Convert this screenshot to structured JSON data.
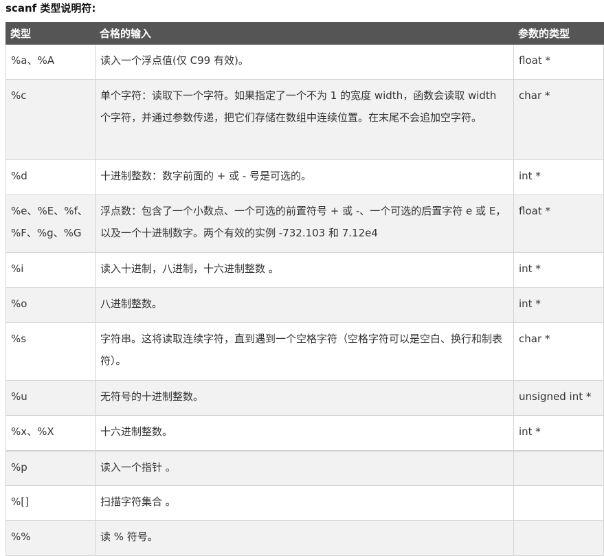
{
  "heading": "scanf 类型说明符:",
  "table": {
    "headers": [
      "类型",
      "合格的输入",
      "参数的类型"
    ],
    "rows": [
      {
        "type": "%a、%A",
        "input": "读入一个浮点值(仅 C99 有效)。",
        "arg": "float *"
      },
      {
        "type": "%c",
        "input": "单个字符：读取下一个字符。如果指定了一个不为 1 的宽度 width，函数会读取 width 个字符，并通过参数传递，把它们存储在数组中连续位置。在末尾不会追加空字符。",
        "arg": "char *"
      },
      {
        "type": "%d",
        "input": "十进制整数：数字前面的 + 或 - 号是可选的。",
        "arg": "int *"
      },
      {
        "type": "%e、%E、%f、%F、%g、%G",
        "input": "浮点数：包含了一个小数点、一个可选的前置符号 + 或 -、一个可选的后置字符 e 或 E，以及一个十进制数字。两个有效的实例 -732.103 和 7.12e4",
        "arg": "float *"
      },
      {
        "type": "%i",
        "input": "读入十进制，八进制，十六进制整数 。",
        "arg": "int *"
      },
      {
        "type": "%o",
        "input": "八进制整数。",
        "arg": "int *"
      },
      {
        "type": "%s",
        "input": "字符串。这将读取连续字符，直到遇到一个空格字符（空格字符可以是空白、换行和制表符）。",
        "arg": "char *"
      },
      {
        "type": "%u",
        "input": "无符号的十进制整数。",
        "arg": "unsigned int *"
      },
      {
        "type": "%x、%X",
        "input": "十六进制整数。",
        "arg": "int *"
      },
      {
        "type": "%p",
        "input": "读入一个指针 。",
        "arg": ""
      },
      {
        "type": "%[]",
        "input": "扫描字符集合 。",
        "arg": ""
      },
      {
        "type": "%%",
        "input": "读 % 符号。",
        "arg": ""
      }
    ]
  },
  "colors": {
    "header_bg": "#555555",
    "header_text": "#ffffff",
    "row_alt_bg": "#f2f2f2",
    "border": "#d4d4d4"
  }
}
